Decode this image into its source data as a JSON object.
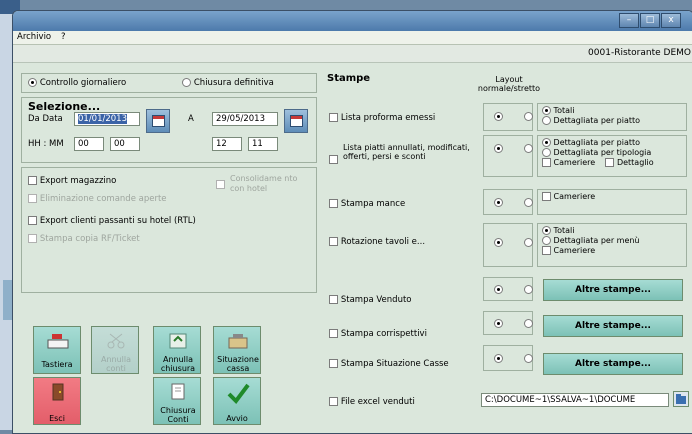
{
  "window": {
    "min_label": "–",
    "max_label": "□",
    "close_label": "x"
  },
  "menu": {
    "archivio": "Archivio",
    "help": "?"
  },
  "company": "0001-Ristorante DEMO",
  "mode": {
    "controllo": "Controllo giornaliero",
    "chiusura": "Chiusura definitiva",
    "selected": "controllo"
  },
  "selezione": {
    "title": "Selezione...",
    "da_data_label": "Da Data",
    "da_data": "01/01/2013",
    "a_label": "A",
    "a_data": "29/05/2013",
    "hhmm_label": "HH : MM",
    "from_hh": "00",
    "from_mm": "00",
    "to_hh": "12",
    "to_mm": "11"
  },
  "options": {
    "export_magazzino": "Export magazzino",
    "eliminazione": "Eliminazione comande aperte",
    "consolidamento": "Consolidame nto con hotel",
    "export_clienti": "Export clienti passanti su hotel (RTL)",
    "stampa_copia": "Stampa copia RF/Ticket"
  },
  "buttons": {
    "tastiera": "Tastiera",
    "annulla_conti": "Annulla conti",
    "annulla_chiusura": "Annulla chiusura",
    "situazione_cassa": "Situazione cassa",
    "esci": "Esci",
    "chiusura_conti": "Chiusura Conti",
    "avvio": "Avvio"
  },
  "stampe": {
    "title": "Stampe",
    "layout_header": "Layout normale/stretto",
    "rows": [
      {
        "label": "Lista proforma emessi",
        "options": [
          "Totali",
          "Dettagliata per piatto"
        ]
      },
      {
        "label": "Lista piatti annullati, modificati, offerti, persi e sconti",
        "options": [
          "Dettagliata per piatto",
          "Dettagliata per tipologia",
          "Cameriere",
          "Dettaglio"
        ]
      },
      {
        "label": "Stampa mance",
        "options": [
          "Cameriere"
        ]
      },
      {
        "label": "Rotazione tavoli e...",
        "options": [
          "Totali",
          "Dettagliata per menù",
          "Cameriere"
        ]
      },
      {
        "label": "Stampa Venduto",
        "button": "Altre stampe..."
      },
      {
        "label": "Stampa corrispettivi",
        "button": "Altre stampe..."
      },
      {
        "label": "Stampa Situazione Casse",
        "button": "Altre stampe..."
      },
      {
        "label": "File excel venduti",
        "path": "C:\\DOCUME~1\\SSALVA~1\\DOCUME"
      }
    ]
  },
  "colors": {
    "accent": "#7cc1b6",
    "exit": "#e35e6a",
    "selection": "#3b63a7"
  }
}
